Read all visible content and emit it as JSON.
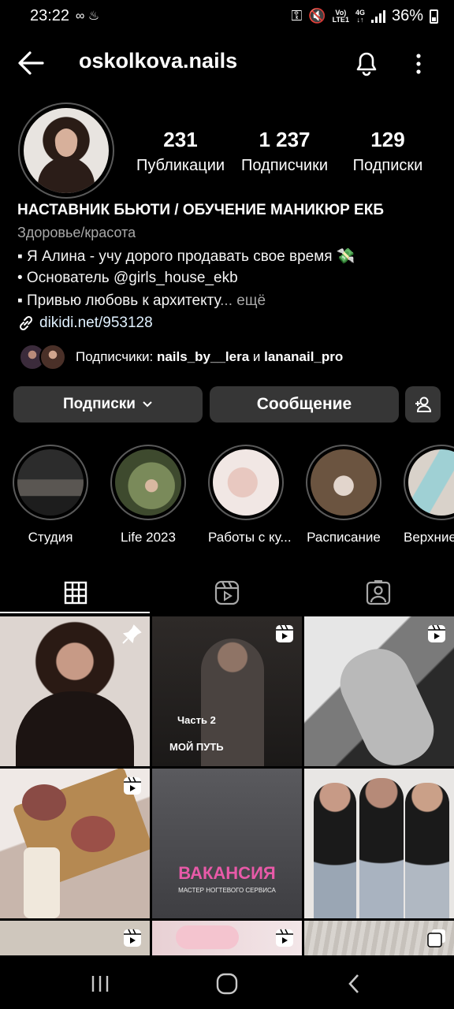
{
  "status": {
    "time": "23:22",
    "battery": "36%"
  },
  "header": {
    "username": "oskolkova.nails"
  },
  "stats": [
    {
      "num": "231",
      "label": "Публикации"
    },
    {
      "num": "1 237",
      "label": "Подписчики"
    },
    {
      "num": "129",
      "label": "Подписки"
    }
  ],
  "bio": {
    "name": "НАСТАВНИК БЬЮТИ / ОБУЧЕНИЕ МАНИКЮР ЕКБ",
    "category": "Здоровье/красота",
    "line1": "▪ Я Алина - учу дорого продавать свое время 💸",
    "line2": "• Основатель @girls_house_ekb",
    "line3": "▪ Привью любовь к архитекту",
    "more": "... ещё",
    "link": "dikidi.net/953128"
  },
  "followed_by": {
    "prefix": "Подписчики: ",
    "user1": "nails_by__lera",
    "and": " и ",
    "user2": "lananail_pro"
  },
  "buttons": {
    "following": "Подписки",
    "message": "Сообщение"
  },
  "highlights": [
    {
      "label": "Студия"
    },
    {
      "label": "Life 2023"
    },
    {
      "label": "Работы с ку..."
    },
    {
      "label": "Расписание"
    },
    {
      "label": "Верхние"
    }
  ],
  "posts": {
    "p2_line1": "Часть 2",
    "p2_line2": "МОЙ ПУТЬ",
    "p5_title": "ВАКАНСИЯ",
    "p5_sub": "МАСТЕР НОГТЕВОГО СЕРВИСА"
  }
}
